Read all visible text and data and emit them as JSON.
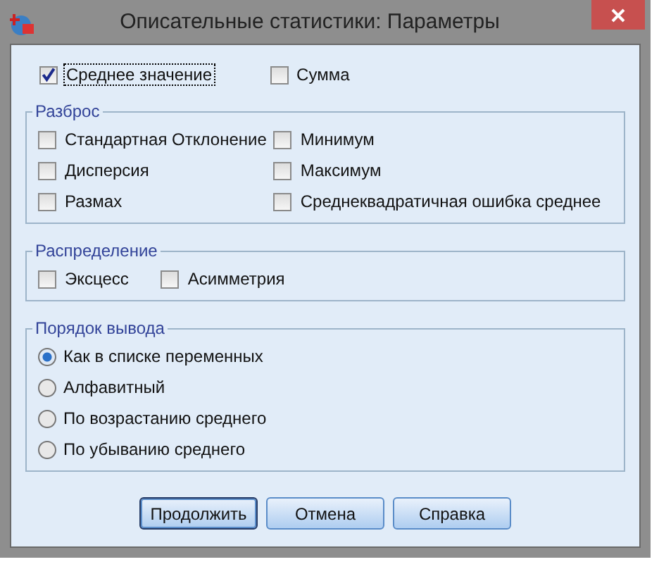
{
  "window": {
    "title": "Описательные статистики: Параметры"
  },
  "top_options": [
    {
      "label": "Среднее значение",
      "checked": true,
      "focused": true
    },
    {
      "label": "Сумма",
      "checked": false,
      "focused": false
    }
  ],
  "groups": [
    {
      "title": "Разброс",
      "kind": "grid",
      "options": [
        {
          "label": "Стандартная Отклонение",
          "checked": false
        },
        {
          "label": "Минимум",
          "checked": false
        },
        {
          "label": "Дисперсия",
          "checked": false
        },
        {
          "label": "Максимум",
          "checked": false
        },
        {
          "label": "Размах",
          "checked": false
        },
        {
          "label": "Среднеквадратичная ошибка среднее",
          "checked": false
        }
      ]
    },
    {
      "title": "Распределение",
      "kind": "row",
      "options": [
        {
          "label": "Эксцесс",
          "checked": false
        },
        {
          "label": "Асимметрия",
          "checked": false
        }
      ]
    }
  ],
  "order": {
    "title": "Порядок вывода",
    "options": [
      {
        "label": "Как в списке переменных",
        "selected": true
      },
      {
        "label": "Алфавитный",
        "selected": false
      },
      {
        "label": "По возрастанию среднего",
        "selected": false
      },
      {
        "label": "По убыванию среднего",
        "selected": false
      }
    ]
  },
  "buttons": [
    {
      "label": "Продолжить",
      "default": true
    },
    {
      "label": "Отмена",
      "default": false
    },
    {
      "label": "Справка",
      "default": false
    }
  ]
}
